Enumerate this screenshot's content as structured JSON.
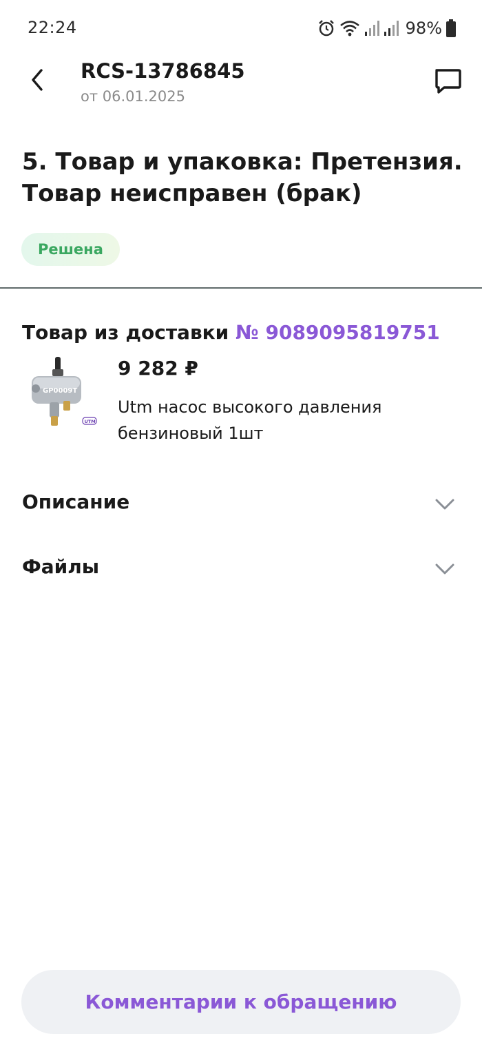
{
  "status_bar": {
    "time": "22:24",
    "battery": "98%",
    "icons": [
      "alarm-icon",
      "wifi-icon",
      "signal-icon",
      "signal-icon",
      "battery-icon"
    ]
  },
  "header": {
    "title": "RCS-13786845",
    "subtitle": "от 06.01.2025",
    "back_icon": "chevron-left-icon",
    "chat_icon": "chat-bubble-icon"
  },
  "topic": {
    "title": "5. Товар и упаковка: Претензия. Товар неисправен (брак)"
  },
  "status_badge": {
    "label": "Решена",
    "color": "#3aa760"
  },
  "delivery": {
    "prefix": "Товар из доставки",
    "link": "№ 9089095819751"
  },
  "product": {
    "price": "9 282 ₽",
    "name": "Utm насос высокого давления бензиновый 1шт",
    "image_icon": "product-image",
    "image_label": "GP0009T",
    "brand_label": "UTM"
  },
  "accordions": {
    "description": "Описание",
    "files": "Файлы"
  },
  "footer": {
    "comments_button": "Комментарии к обращению"
  },
  "colors": {
    "accent": "#8a58d6",
    "success": "#3aa760",
    "text": "#1a1a1a",
    "muted": "#8a8a8a"
  }
}
